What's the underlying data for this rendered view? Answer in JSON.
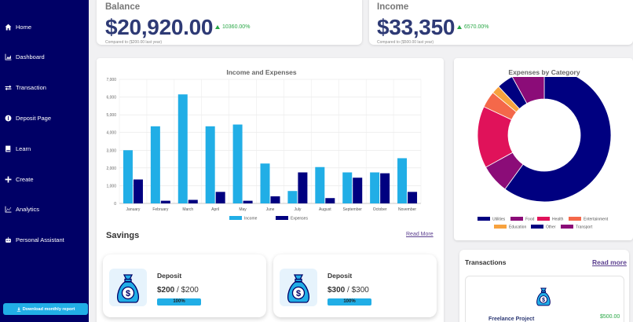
{
  "sidebar": {
    "items": [
      {
        "label": "Home",
        "icon": "home-icon"
      },
      {
        "label": "Dashboard",
        "icon": "chart-icon"
      },
      {
        "label": "Transaction",
        "icon": "exchange-icon"
      },
      {
        "label": "Deposit Page",
        "icon": "deposit-icon"
      },
      {
        "label": "Learn",
        "icon": "book-icon"
      },
      {
        "label": "Create",
        "icon": "plus-icon"
      },
      {
        "label": "Analytics",
        "icon": "analytics-icon"
      },
      {
        "label": "Personal Assistant",
        "icon": "robot-icon"
      }
    ],
    "download_label": "Download monthly report"
  },
  "balance": {
    "title": "Balance",
    "value": "$20,920.00",
    "change": "10360.00%",
    "compared": "Compared to ($200.00 last year)"
  },
  "income": {
    "title": "Income",
    "value": "$33,350",
    "change": "6570.00%",
    "compared": "Compared to ($500.00 last year)"
  },
  "colors": {
    "sidebar": "#000066",
    "income_bar": "#21aee6",
    "expense_bar": "#000080",
    "positive": "#28a745"
  },
  "chart_data": [
    {
      "type": "bar",
      "title": "Income and Expenses",
      "categories": [
        "January",
        "February",
        "March",
        "April",
        "May",
        "June",
        "July",
        "August",
        "September",
        "October",
        "November"
      ],
      "series": [
        {
          "name": "Income",
          "color": "#21aee6",
          "values": [
            3000,
            4350,
            6150,
            4350,
            4450,
            2250,
            700,
            2050,
            1750,
            1750,
            2550
          ]
        },
        {
          "name": "Expenses",
          "color": "#000080",
          "values": [
            1350,
            150,
            200,
            650,
            150,
            400,
            1750,
            300,
            1450,
            1700,
            650
          ]
        }
      ],
      "ylim": [
        0,
        7000
      ],
      "yticks": [
        "0",
        "1,000",
        "2,000",
        "3,000",
        "4,000",
        "5,000",
        "6,000",
        "7,000"
      ],
      "grid": true,
      "legend": "bottom"
    },
    {
      "type": "pie",
      "title": "Expenses by Category",
      "slices": [
        {
          "name": "Utilities",
          "color": "#000080",
          "value": 60
        },
        {
          "name": "Food",
          "color": "#8b0c78",
          "value": 7
        },
        {
          "name": "Health",
          "color": "#e0125a",
          "value": 15
        },
        {
          "name": "Entertainment",
          "color": "#f4684a",
          "value": 4
        },
        {
          "name": "Education",
          "color": "#f7a23e",
          "value": 2
        },
        {
          "name": "Other",
          "color": "#000080",
          "value": 4
        },
        {
          "name": "Transport",
          "color": "#8b0c78",
          "value": 8
        }
      ],
      "legend": "bottom"
    }
  ],
  "savings": {
    "title": "Savings",
    "read_more": "Read More",
    "items": [
      {
        "label": "Deposit",
        "current": "$200",
        "target": "/ $200",
        "percent": "100%",
        "progress": 1.0
      },
      {
        "label": "Deposit",
        "current": "$300",
        "target": "/ $300",
        "percent": "100%",
        "progress": 1.0
      }
    ]
  },
  "transactions": {
    "title": "Transactions",
    "read_more": "Read more",
    "items": [
      {
        "name": "Freelance Project",
        "amount": "$500.00"
      }
    ]
  }
}
